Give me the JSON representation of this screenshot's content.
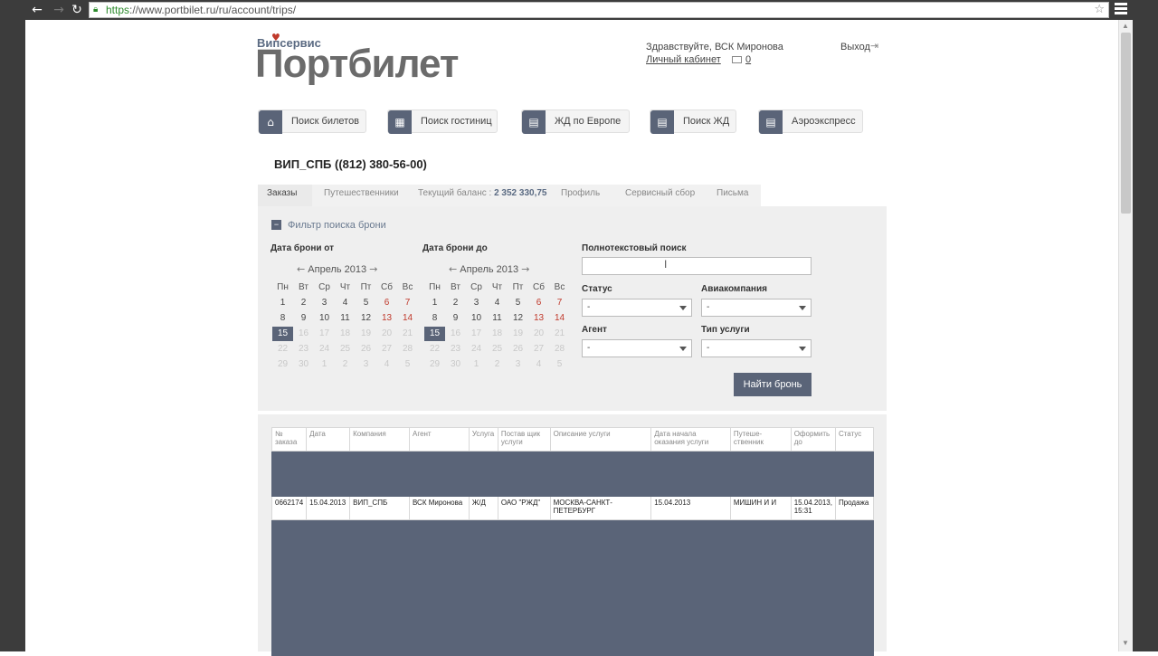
{
  "browser": {
    "url_secure": "https",
    "url_rest": "://www.portbilet.ru/ru/account/trips/",
    "back_icon": "←",
    "forward_icon": "→",
    "reload_icon": "↻",
    "star_icon": "☆"
  },
  "header": {
    "logo_small": "Випсервис",
    "logo_big": "Портбилет",
    "greeting": "Здравствуйте, ВСК Миронова",
    "cabinet_link": "Личный кабинет",
    "mail_count": "0",
    "logout": "Выход"
  },
  "nav": [
    {
      "label": "Поиск билетов",
      "icon": "⌂"
    },
    {
      "label": "Поиск гостиниц",
      "icon": "▦"
    },
    {
      "label": "ЖД по Европе",
      "icon": "▤"
    },
    {
      "label": "Поиск ЖД",
      "icon": "▤"
    },
    {
      "label": "Аэроэкспресс",
      "icon": "▤"
    }
  ],
  "agency": "ВИП_СПБ ((812) 380-56-00)",
  "subtabs": {
    "orders": "Заказы",
    "travelers": "Путешественники",
    "balance_label": "Текущий баланс :",
    "balance_value": "2 352 330,75",
    "profile": "Профиль",
    "service_fee": "Сервисный сбор",
    "letters": "Письма"
  },
  "filter": {
    "toggle": "−",
    "title": "Фильтр поиска брони",
    "date_from_label": "Дата брони от",
    "date_to_label": "Дата брони до",
    "month": "Апрель 2013",
    "prev_arrow": "←",
    "next_arrow": "→",
    "fulltext_label": "Полнотекстовый поиск",
    "fulltext_value": "",
    "status_label": "Статус",
    "status_value": "-",
    "airline_label": "Авиакомпания",
    "airline_value": "-",
    "agent_label": "Агент",
    "agent_value": "-",
    "service_type_label": "Тип услуги",
    "service_type_value": "-",
    "find_button": "Найти бронь"
  },
  "calendar": {
    "weekdays": [
      "Пн",
      "Вт",
      "Ср",
      "Чт",
      "Пт",
      "Сб",
      "Вс"
    ],
    "weeks": [
      [
        "1",
        "2",
        "3",
        "4",
        "5",
        "6",
        "7"
      ],
      [
        "8",
        "9",
        "10",
        "11",
        "12",
        "13",
        "14"
      ],
      [
        "15",
        "16",
        "17",
        "18",
        "19",
        "20",
        "21"
      ],
      [
        "22",
        "23",
        "24",
        "25",
        "26",
        "27",
        "28"
      ],
      [
        "29",
        "30",
        "1",
        "2",
        "3",
        "4",
        "5"
      ]
    ],
    "selected": "15"
  },
  "table": {
    "headers": [
      "№ заказа",
      "Дата",
      "Компания",
      "Агент",
      "Услуга",
      "Постав щик услуги",
      "Описание услуги",
      "Дата начала оказания услуги",
      "Путеше-ственник",
      "Оформить до",
      "Статус"
    ],
    "rows": [
      [
        "0662174",
        "15.04.2013",
        "ВИП_СПБ",
        "ВСК Миронова",
        "Ж/Д",
        "ОАО \"РЖД\"",
        "МОСКВА-САНКТ-ПЕТЕРБУРГ",
        "15.04.2013",
        "МИШИН И И",
        "15.04.2013, 15:31",
        "Продажа"
      ]
    ]
  },
  "colors": {
    "accent": "#5a6478",
    "weekend": "#c0392b"
  }
}
